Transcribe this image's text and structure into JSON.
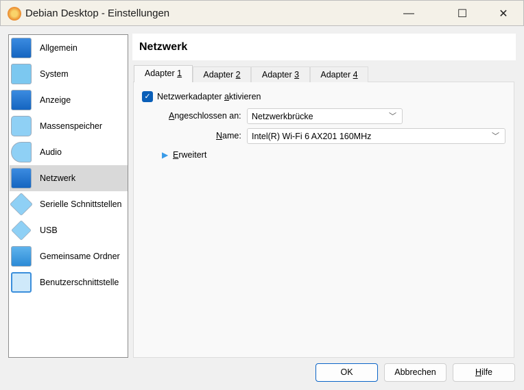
{
  "window": {
    "title": "Debian Desktop - Einstellungen",
    "minimize": "—",
    "maximize": "☐",
    "close": "✕"
  },
  "sidebar": {
    "items": [
      {
        "label": "Allgemein"
      },
      {
        "label": "System"
      },
      {
        "label": "Anzeige"
      },
      {
        "label": "Massenspeicher"
      },
      {
        "label": "Audio"
      },
      {
        "label": "Netzwerk",
        "selected": true
      },
      {
        "label": "Serielle Schnittstellen"
      },
      {
        "label": "USB"
      },
      {
        "label": "Gemeinsame Ordner"
      },
      {
        "label": "Benutzerschnittstelle"
      }
    ]
  },
  "page": {
    "title": "Netzwerk"
  },
  "tabs": [
    {
      "prefix": "Adapter ",
      "key": "1"
    },
    {
      "prefix": "Adapter ",
      "key": "2"
    },
    {
      "prefix": "Adapter ",
      "key": "3"
    },
    {
      "prefix": "Adapter ",
      "key": "4"
    }
  ],
  "adapter": {
    "enable_pre": "Netzwerkadapter ",
    "enable_key": "a",
    "enable_post": "ktivieren",
    "enabled": true,
    "attached_key": "A",
    "attached_label": "ngeschlossen an:",
    "attached_value": "Netzwerkbrücke",
    "name_key": "N",
    "name_label": "ame:",
    "name_value": "Intel(R) Wi-Fi 6 AX201 160MHz",
    "advanced_key": "E",
    "advanced_label": "rweitert"
  },
  "buttons": {
    "ok": "OK",
    "cancel": "Abbrechen",
    "help_key": "H",
    "help": "ilfe"
  }
}
